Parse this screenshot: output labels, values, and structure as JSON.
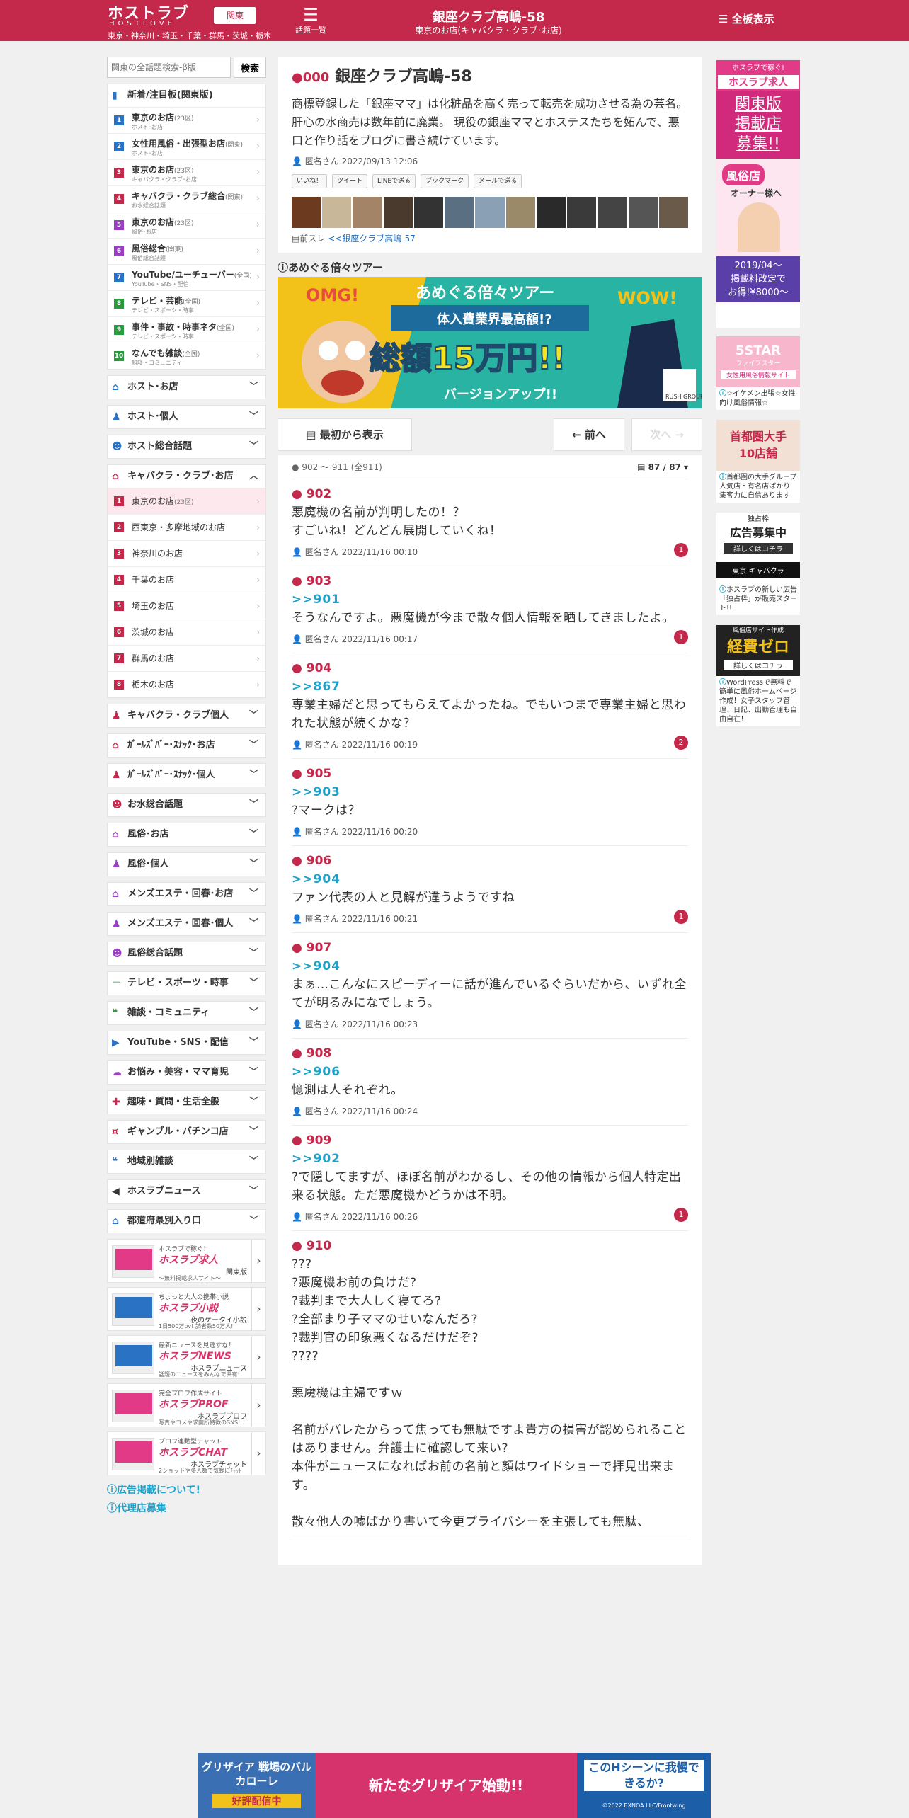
{
  "header": {
    "logo": "ホストラブ",
    "logo_sub": "HOSTLOVE",
    "region": "東京・神奈川・埼玉・千葉・群馬・茨城・栃木",
    "region_button": "関東",
    "menu_icon": "menu-icon",
    "menu_label": "話題一覧",
    "title": "銀座クラブ高嶋-58",
    "subtitle": "東京のお店(キャバクラ・クラブ･お店)",
    "all_label": "全板表示",
    "bg": "#c4284a"
  },
  "search": {
    "placeholder": "関東の全話題検索-β版",
    "button": "検索"
  },
  "sidebar": {
    "new_title": "新着/注目板(関東版)",
    "new_items": [
      {
        "num": "1",
        "label": "東京のお店",
        "small": "(23区)",
        "sub": "ホスト･お店",
        "color": "#2a73c4"
      },
      {
        "num": "2",
        "label": "女性用風俗・出張型お店",
        "small": "(関東)",
        "sub": "ホスト･お店",
        "color": "#2a73c4"
      },
      {
        "num": "3",
        "label": "東京のお店",
        "small": "(23区)",
        "sub": "キャバクラ・クラブ･お店",
        "color": "#c4284a"
      },
      {
        "num": "4",
        "label": "キャバクラ・クラブ総合",
        "small": "(関東)",
        "sub": "お水総合話題",
        "color": "#c4284a"
      },
      {
        "num": "5",
        "label": "東京のお店",
        "small": "(23区)",
        "sub": "風俗･お店",
        "color": "#9a3fc4"
      },
      {
        "num": "6",
        "label": "風俗総合",
        "small": "(関東)",
        "sub": "風俗総合話題",
        "color": "#9a3fc4"
      },
      {
        "num": "7",
        "label": "YouTube/ユーチューバー",
        "small": "(全国)",
        "sub": "YouTube・SNS・配信",
        "color": "#2a73c4"
      },
      {
        "num": "8",
        "label": "テレビ・芸能",
        "small": "(全国)",
        "sub": "テレビ・スポーツ・時事",
        "color": "#2a9a3f"
      },
      {
        "num": "9",
        "label": "事件・事故・時事ネタ",
        "small": "(全国)",
        "sub": "テレビ・スポーツ・時事",
        "color": "#2a9a3f"
      },
      {
        "num": "10",
        "label": "なんでも雑談",
        "small": "(全国)",
        "sub": "雑談・コミュニティ",
        "color": "#2a9a3f"
      }
    ],
    "cats_top": [
      {
        "label": "ホスト･お店",
        "icon": "house-icon",
        "color": "#2a73c4"
      },
      {
        "label": "ホスト･個人",
        "icon": "person-icon",
        "color": "#2a73c4"
      },
      {
        "label": "ホスト総合話題",
        "icon": "group-icon",
        "color": "#2a73c4"
      }
    ],
    "kyaba_title": "キャバクラ・クラブ･お店",
    "kyaba_items": [
      {
        "num": "1",
        "label": "東京のお店",
        "small": "(23区)"
      },
      {
        "num": "2",
        "label": "西東京・多摩地域のお店",
        "small": ""
      },
      {
        "num": "3",
        "label": "神奈川のお店",
        "small": ""
      },
      {
        "num": "4",
        "label": "千葉のお店",
        "small": ""
      },
      {
        "num": "5",
        "label": "埼玉のお店",
        "small": ""
      },
      {
        "num": "6",
        "label": "茨城のお店",
        "small": ""
      },
      {
        "num": "7",
        "label": "群馬のお店",
        "small": ""
      },
      {
        "num": "8",
        "label": "栃木のお店",
        "small": ""
      }
    ],
    "cats_bottom": [
      {
        "label": "キャバクラ・クラブ個人",
        "icon": "person-icon",
        "color": "#c4284a"
      },
      {
        "label": "ｶﾞｰﾙｽﾞﾊﾞｰ･ｽﾅｯｸ･お店",
        "icon": "house-icon",
        "color": "#c4284a"
      },
      {
        "label": "ｶﾞｰﾙｽﾞﾊﾞｰ･ｽﾅｯｸ･個人",
        "icon": "person-icon",
        "color": "#c4284a"
      },
      {
        "label": "お水総合話題",
        "icon": "group-icon",
        "color": "#c4284a"
      },
      {
        "label": "風俗･お店",
        "icon": "house-icon",
        "color": "#9a3fc4"
      },
      {
        "label": "風俗･個人",
        "icon": "person-icon",
        "color": "#9a3fc4"
      },
      {
        "label": "メンズエステ・回春･お店",
        "icon": "house-icon",
        "color": "#9a3fc4"
      },
      {
        "label": "メンズエステ・回春･個人",
        "icon": "person-icon",
        "color": "#9a3fc4"
      },
      {
        "label": "風俗総合話題",
        "icon": "group-icon",
        "color": "#9a3fc4"
      },
      {
        "label": "テレビ・スポーツ・時事",
        "icon": "tv-icon",
        "color": "#2a9a3f"
      },
      {
        "label": "雑談・コミュニティ",
        "icon": "chat-icon",
        "color": "#2a9a3f"
      },
      {
        "label": "YouTube・SNS・配信",
        "icon": "youtube-icon",
        "color": "#2a73c4"
      },
      {
        "label": "お悩み・美容・ママ育児",
        "icon": "cloud-icon",
        "color": "#9a3fc4"
      },
      {
        "label": "趣味・質問・生活全般",
        "icon": "tag-icon",
        "color": "#c4284a"
      },
      {
        "label": "ギャンブル・パチンコ店",
        "icon": "money-icon",
        "color": "#c4284a"
      },
      {
        "label": "地域別雑談",
        "icon": "chat-icon",
        "color": "#2a73c4"
      },
      {
        "label": "ホスラブニュース",
        "icon": "speaker-icon",
        "color": "#333333"
      },
      {
        "label": "都道府県別入り口",
        "icon": "house-icon",
        "color": "#2a73c4"
      }
    ],
    "promos": [
      {
        "line1": "ホスラブで稼ぐ！",
        "title": "ホスラブ求人",
        "sub": "関東版",
        "sub2": "〜無料掲載求人サイト〜"
      },
      {
        "line1": "ちょっと大人の携帯小説",
        "title": "ホスラブ小説",
        "sub": "夜のケータイ小説",
        "sub2": "1日500万pv! 読者数50万人!"
      },
      {
        "line1": "最新ニュースを見逃すな！",
        "title": "ホスラブNEWS",
        "sub": "ホスラブニュース",
        "sub2": "話題のニュースをみんなで共有!"
      },
      {
        "line1": "完全プロフ作成サイト",
        "title": "ホスラブPROF",
        "sub": "ホスラブプロフ",
        "sub2": "写真やコメや求案所特徴のSNS!"
      },
      {
        "line1": "プロフ連動型チャット",
        "title": "ホスラブCHAT",
        "sub": "ホスラブチャット",
        "sub2": "2ショットや多人数で気軽にﾁｬｯﾄ"
      }
    ],
    "footer_links": [
      "広告掲載について!",
      "代理店募集"
    ]
  },
  "thread": {
    "num": "000",
    "title": "銀座クラブ高嶋-58",
    "desc": "商標登録した「銀座ママ」は化粧品を高く売って転売を成功させる為の芸名。 肝心の水商売は数年前に廃業。 現役の銀座ママとホステスたちを妬んで、悪口と作り話をブログに書き続けています。",
    "author": "匿名さん 2022/09/13 12:06",
    "shares": [
      "いいね！",
      "ツイート",
      "LINEで送る",
      "ブックマーク",
      "メールで送る"
    ],
    "prev_label": "前スレ",
    "prev_link": "<<銀座クラブ高嶋-57"
  },
  "ad_title": "あめぐる倍々ツアー",
  "banner": {
    "omg": "OMG!",
    "wow": "WOW!",
    "title": "あめぐる倍々ツアー",
    "sub": "体入費業界最高額!?",
    "main": "総額15万円!!",
    "ver": "バージョンアップ!!",
    "brand": "RUSH GROUP"
  },
  "nav": {
    "first": "最初から表示",
    "prev": "前へ",
    "next": "次へ"
  },
  "posts_head": {
    "range": "902 〜 911 (全911)",
    "page": "87 / 87"
  },
  "posts": [
    {
      "num": "902",
      "ref": "",
      "body": "悪魔機の名前が判明したの！？\nすごいね！どんどん展開していくね！",
      "meta": "匿名さん 2022/11/16 00:10",
      "rc": "1"
    },
    {
      "num": "903",
      "ref": ">>901",
      "body": "そうなんですよ。悪魔機が今まで散々個人情報を晒してきましたよ。",
      "meta": "匿名さん 2022/11/16 00:17",
      "rc": "1"
    },
    {
      "num": "904",
      "ref": ">>867",
      "body": "専業主婦だと思ってもらえてよかったね。でもいつまで専業主婦と思われた状態が続くかな？",
      "meta": "匿名さん 2022/11/16 00:19",
      "rc": "2"
    },
    {
      "num": "905",
      "ref": ">>903",
      "body": "?マークは？",
      "meta": "匿名さん 2022/11/16 00:20",
      "rc": ""
    },
    {
      "num": "906",
      "ref": ">>904",
      "body": "ファン代表の人と見解が違うようですね",
      "meta": "匿名さん 2022/11/16 00:21",
      "rc": "1"
    },
    {
      "num": "907",
      "ref": ">>904",
      "body": "まぁ…こんなにスピーディーに話が進んでいるぐらいだから、いずれ全てが明るみになでしょう。",
      "meta": "匿名さん 2022/11/16 00:23",
      "rc": ""
    },
    {
      "num": "908",
      "ref": ">>906",
      "body": "憶測は人それぞれ。",
      "meta": "匿名さん 2022/11/16 00:24",
      "rc": ""
    },
    {
      "num": "909",
      "ref": ">>902",
      "body": "?で隠してますが、ほぼ名前がわかるし、その他の情報から個人特定出来る状態。ただ悪魔機かどうかは不明。",
      "meta": "匿名さん 2022/11/16 00:26",
      "rc": "1"
    },
    {
      "num": "910",
      "ref": "",
      "body": "???\n?悪魔機お前の負けだ?\n?裁判まで大人しく寝てろ?\n?全部まり子ママのせいなんだろ?\n?裁判官の印象悪くなるだけだぞ?\n????\n\n悪魔機は主婦ですｗ\n\n名前がバレたからって焦っても無駄ですよ貴方の損害が認められることはありません。弁護士に確認して来い?\n本件がニュースになればお前の名前と顔はワイドショーで拝見出来ます。\n\n散々他人の嘘ばかり書いて今更プライバシーを主張しても無駄、",
      "meta": "",
      "rc": ""
    }
  ],
  "right_ads": [
    {
      "lines": [
        "ホスラブで稼ぐ!",
        "ホスラブ求人",
        "関東版",
        "掲載店",
        "募集!!",
        "風俗店",
        "オーナー様へ",
        "2019/04〜",
        "掲載料改定で",
        "お得!¥8000〜"
      ],
      "caption": ""
    },
    {
      "lines": [
        "5STAR",
        "ファイブスター",
        "女性用風俗情報サイト"
      ],
      "caption": "☆イケメン出張☆女性向け風俗情報☆"
    },
    {
      "lines": [
        "首都圏大手",
        "10店舗"
      ],
      "caption": "首都圏の大手グループ 人気店・有名店ばかり 集客力に自信あります"
    },
    {
      "lines": [
        "独占枠",
        "広告募集中",
        "詳しくはコチラ",
        "東京 キャバクラ"
      ],
      "caption": "ホスラブの新しい広告「独占枠」が販売スタート!!"
    },
    {
      "lines": [
        "風俗店サイト作成",
        "経費ゼロ",
        "詳しくはコチラ"
      ],
      "caption": "WordPressで無料で簡単に風俗ホームページ作成！女子スタッフ管理、日記、出勤管理も自由自在！"
    }
  ],
  "bottom_ad": {
    "left": "グリザイア 戦場のバルカローレ",
    "left_sub": "好評配信中",
    "mid": "新たなグリザイア始動!!",
    "right": "このHシーンに我慢できるか?",
    "copy": "©2022 EXNOA LLC/Frontwing"
  }
}
